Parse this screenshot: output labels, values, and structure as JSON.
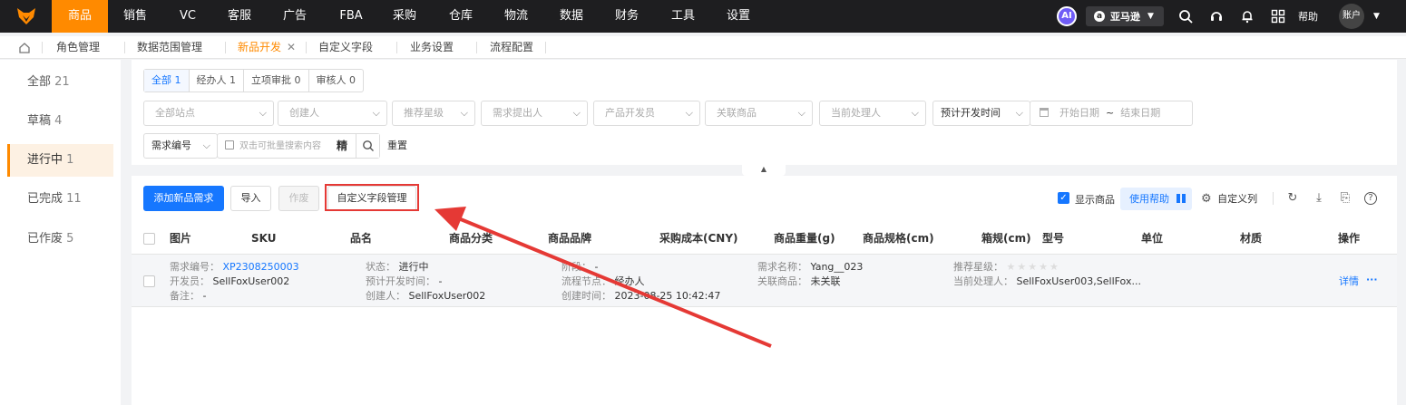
{
  "topnav": {
    "items": [
      "商品",
      "销售",
      "VC",
      "客服",
      "广告",
      "FBA",
      "采购",
      "仓库",
      "物流",
      "数据",
      "财务",
      "工具",
      "设置"
    ],
    "active_index": 0,
    "ai_label": "AI",
    "marketplace": "亚马逊",
    "help": "帮助",
    "account": "账户",
    "colors": {
      "bg": "#1e1e20",
      "accent": "#ff8a00"
    }
  },
  "tabs": [
    {
      "label": "角色管理"
    },
    {
      "label": "数据范围管理"
    },
    {
      "label": "新品开发",
      "active": true
    },
    {
      "label": "自定义字段"
    },
    {
      "label": "业务设置"
    },
    {
      "label": "流程配置"
    }
  ],
  "sidebar": [
    {
      "label": "全部",
      "count": "21"
    },
    {
      "label": "草稿",
      "count": "4"
    },
    {
      "label": "进行中",
      "count": "1",
      "active": true
    },
    {
      "label": "已完成",
      "count": "11"
    },
    {
      "label": "已作废",
      "count": "5"
    }
  ],
  "filters": {
    "segments": [
      "全部 1",
      "经办人 1",
      "立项审批 0",
      "审核人 0"
    ],
    "selects": [
      "全部站点",
      "创建人",
      "推荐星级",
      "需求提出人",
      "产品开发员",
      "关联商品",
      "当前处理人"
    ],
    "date_type": "预计开发时间",
    "start_date": "开始日期",
    "date_sep": "~",
    "end_date": "结束日期",
    "search_type": "需求编号",
    "search_placeholder": "双击可批量搜索内容",
    "exact_label": "精",
    "reset": "重置"
  },
  "toolbar": {
    "add": "添加新品需求",
    "import": "导入",
    "void": "作废",
    "custom_field": "自定义字段管理",
    "show_product": "显示商品",
    "use_help": "使用帮助",
    "custom_columns": "自定义列"
  },
  "table": {
    "headers": [
      "图片",
      "SKU",
      "品名",
      "商品分类",
      "商品品牌",
      "采购成本(CNY)",
      "商品重量(g)",
      "商品规格(cm)",
      "箱规(cm)",
      "型号",
      "单位",
      "材质",
      "操作"
    ],
    "row": {
      "req_no_k": "需求编号：",
      "req_no_v": "XP2308250003",
      "dev_k": "开发员：",
      "dev_v": "SellFoxUser002",
      "note_k": "备注：",
      "note_v": "-",
      "status_k": "状态：",
      "status_v": "进行中",
      "plan_k": "预计开发时间：",
      "plan_v": "-",
      "creator_k": "创建人：",
      "creator_v": "SellFoxUser002",
      "level_k": "阶段：",
      "level_v": "-",
      "node_k": "流程节点：",
      "node_v": "经办人",
      "ctime_k": "创建时间：",
      "ctime_v": "2023-08-25 10:42:47",
      "name_k": "需求名称：",
      "name_v": "Yang__023",
      "link_k": "关联商品：",
      "link_v": "未关联",
      "star_k": "推荐星级：",
      "handler_k": "当前处理人：",
      "handler_v": "SellFoxUser003,SellFox...",
      "detail": "详情",
      "more": "···"
    }
  }
}
